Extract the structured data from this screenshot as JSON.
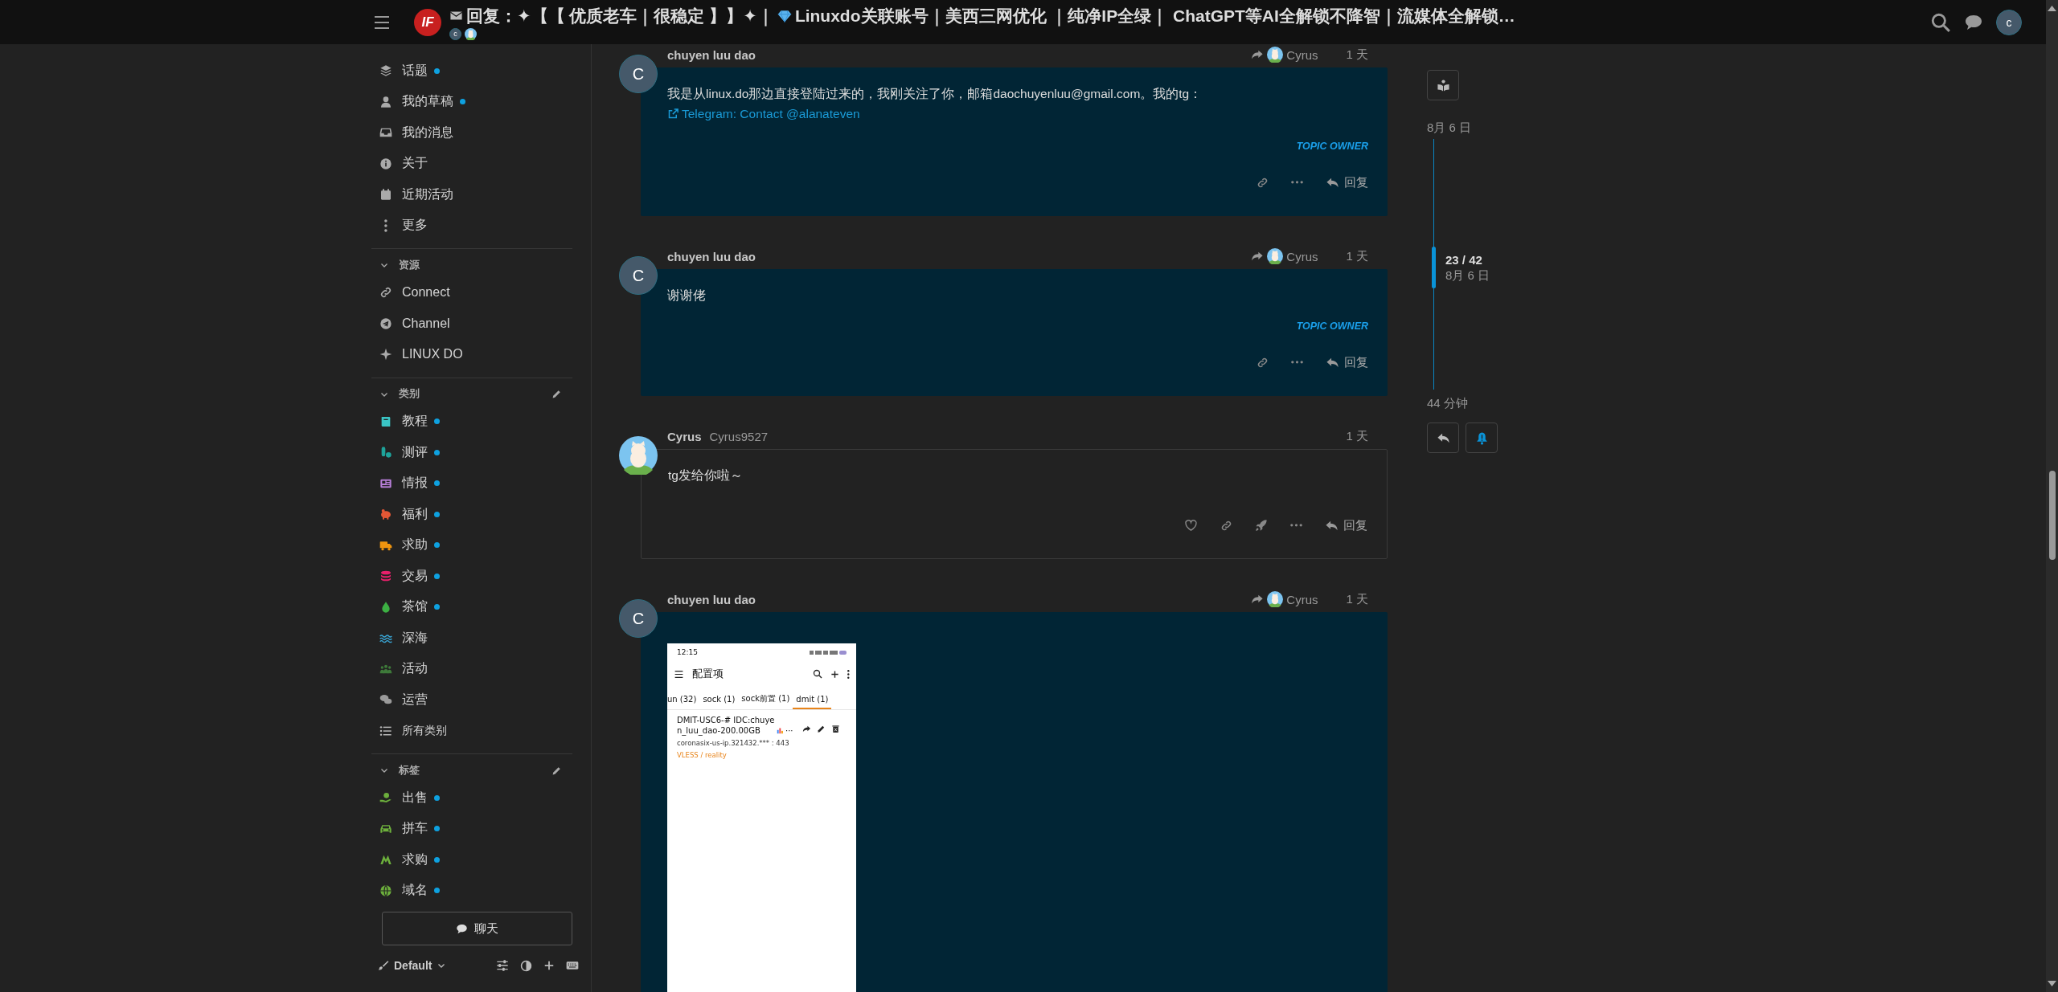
{
  "header": {
    "logo": "IF",
    "title_before_icon": "回复：✦【【 优质老车｜很稳定 】】✦｜",
    "title_after_icon": "Linuxdo关联账号｜美西三网优化 ｜纯净IP全绿｜ ChatGPT等AI全解锁不降智｜流媒体全解锁…",
    "participants": [
      {
        "kind": "letter",
        "letter": "c"
      },
      {
        "kind": "picture"
      }
    ],
    "user_avatar": "c"
  },
  "sidebar": {
    "main_items": [
      {
        "label": "话题",
        "unread": true
      },
      {
        "label": "我的草稿",
        "unread": true
      },
      {
        "label": "我的消息",
        "unread": false
      },
      {
        "label": "关于",
        "unread": false
      },
      {
        "label": "近期活动",
        "unread": false
      },
      {
        "label": "更多",
        "unread": false
      }
    ],
    "sections": [
      {
        "title": "资源",
        "expanded": true,
        "editable": false,
        "items": [
          {
            "label": "Connect",
            "unread": false
          },
          {
            "label": "Channel",
            "unread": false
          },
          {
            "label": "LINUX DO",
            "unread": false
          }
        ]
      },
      {
        "title": "类别",
        "expanded": true,
        "editable": true,
        "items": [
          {
            "label": "教程",
            "unread": true,
            "color": "#3ac4c4"
          },
          {
            "label": "测评",
            "unread": true,
            "color": "#1ea39a"
          },
          {
            "label": "情报",
            "unread": true,
            "color": "#b87fd9"
          },
          {
            "label": "福利",
            "unread": true,
            "color": "#e45735"
          },
          {
            "label": "求助",
            "unread": true,
            "color": "#f1950f"
          },
          {
            "label": "交易",
            "unread": true,
            "color": "#e9206b"
          },
          {
            "label": "茶馆",
            "unread": true,
            "color": "#3cb043"
          },
          {
            "label": "深海",
            "unread": false,
            "color": "#3aa8d8"
          },
          {
            "label": "活动",
            "unread": false,
            "color": "#3e7a3a"
          },
          {
            "label": "运营",
            "unread": false,
            "color": "#9a9a9a"
          },
          {
            "label": "所有类别",
            "unread": false,
            "color": "#bbbbbb"
          }
        ]
      },
      {
        "title": "标签",
        "expanded": true,
        "editable": true,
        "items": [
          {
            "label": "出售",
            "unread": true,
            "color": "#6caf3c"
          },
          {
            "label": "拼车",
            "unread": true,
            "color": "#6caf3c"
          },
          {
            "label": "求购",
            "unread": true,
            "color": "#6caf3c"
          },
          {
            "label": "域名",
            "unread": true,
            "color": "#6caf3c"
          }
        ]
      }
    ],
    "chat_button": "聊天",
    "theme": "Default"
  },
  "posts": [
    {
      "author": "chuyen luu dao",
      "avatar": {
        "kind": "letter",
        "letter": "C"
      },
      "reply_to": "Cyrus",
      "time": "1 天",
      "highlighted": true,
      "can_like": false,
      "body": "我是从linux.do那边直接登陆过来的，我刚关注了你，邮箱daochuyenluu@gmail.com。我的tg：",
      "link": "Telegram: Contact @alanateven",
      "badge": "TOPIC OWNER",
      "reply_label": "回复"
    },
    {
      "author": "chuyen luu dao",
      "avatar": {
        "kind": "letter",
        "letter": "C"
      },
      "reply_to": "Cyrus",
      "time": "1 天",
      "highlighted": true,
      "can_like": false,
      "body": "谢谢佬",
      "badge": "TOPIC OWNER",
      "reply_label": "回复"
    },
    {
      "author": "Cyrus",
      "username": "Cyrus9527",
      "avatar": {
        "kind": "picture"
      },
      "time": "1 天",
      "highlighted": false,
      "can_like": true,
      "body": "tg发给你啦～",
      "reply_label": "回复"
    },
    {
      "author": "chuyen luu dao",
      "avatar": {
        "kind": "letter",
        "letter": "C"
      },
      "reply_to": "Cyrus",
      "time": "1 天",
      "highlighted": true,
      "screenshot": {
        "time": "12:15",
        "title": "配置项",
        "tabs": [
          {
            "label": "un (32)",
            "selected": false
          },
          {
            "label": "sock (1)",
            "selected": false
          },
          {
            "label": "sock前置 (1)",
            "selected": false
          },
          {
            "label": "dmit (1)",
            "selected": true
          }
        ],
        "entry": {
          "name": "DMIT-USC6-# IDC:chuyen_luu_dao-200.00GB",
          "more": "···",
          "address": "coronasix-us-ip.321432.*** : 443",
          "protocol": "VLESS / reality"
        }
      }
    }
  ],
  "timeline": {
    "start_date": "8月 6 日",
    "position": "23 / 42",
    "position_date": "8月 6 日",
    "end_label": "44 分钟",
    "watching": true
  }
}
